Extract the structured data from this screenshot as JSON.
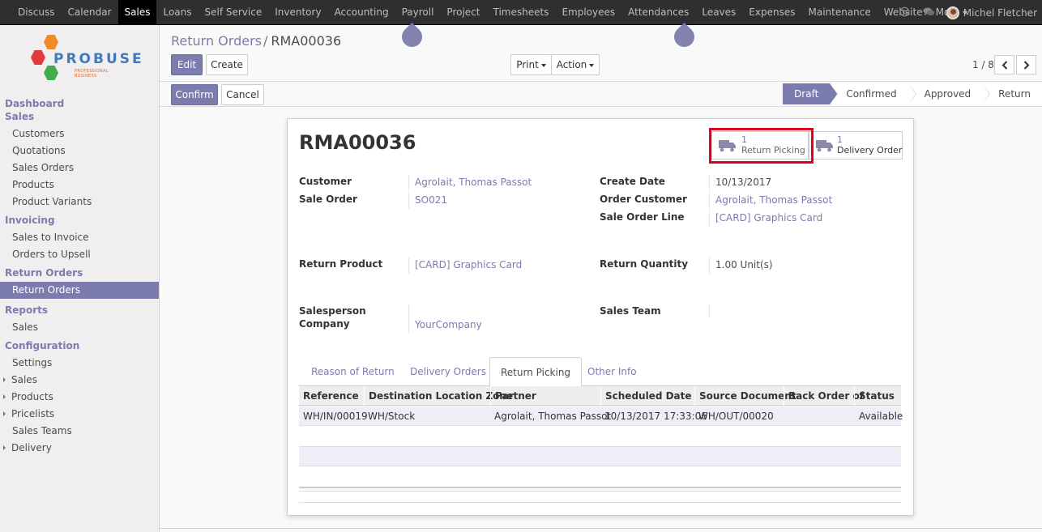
{
  "topbar": {
    "menu": [
      "Discuss",
      "Calendar",
      "Sales",
      "Loans",
      "Self Service",
      "Inventory",
      "Accounting",
      "Payroll",
      "Project",
      "Timesheets",
      "Employees",
      "Attendances",
      "Leaves",
      "Expenses",
      "Maintenance",
      "Website",
      "More"
    ],
    "active": "Sales",
    "user_name": "Michel Fletcher",
    "icons": [
      "at-icon",
      "chat-icon",
      "avatar"
    ]
  },
  "logo": {
    "brand": "PROBUSE",
    "tagline": "PROFESSIONAL BUSINESS"
  },
  "sidebar": {
    "dashboard": "Dashboard",
    "sales_head": "Sales",
    "sales_items": [
      "Customers",
      "Quotations",
      "Sales Orders",
      "Products",
      "Product Variants"
    ],
    "invoicing_head": "Invoicing",
    "invoicing_items": [
      "Sales to Invoice",
      "Orders to Upsell"
    ],
    "return_head": "Return Orders",
    "return_items": [
      "Return Orders"
    ],
    "reports_head": "Reports",
    "reports_items": [
      "Sales"
    ],
    "config_head": "Configuration",
    "config_items": [
      "Settings"
    ],
    "config_sub": [
      "Sales",
      "Products",
      "Pricelists"
    ],
    "config_items2": [
      "Sales Teams"
    ],
    "config_sub2": [
      "Delivery"
    ]
  },
  "breadcrumb": {
    "parent": "Return Orders",
    "separator": "/",
    "current": "RMA00036"
  },
  "buttons": {
    "edit": "Edit",
    "create": "Create",
    "print": "Print",
    "action": "Action",
    "confirm": "Confirm",
    "cancel": "Cancel"
  },
  "pager": {
    "value": "1 / 8"
  },
  "stages": [
    "Draft",
    "Confirmed",
    "Approved",
    "Return"
  ],
  "active_stage": "Draft",
  "record": {
    "name": "RMA00036",
    "smart_buttons": [
      {
        "count": "1",
        "label": "Return Picking"
      },
      {
        "count": "1",
        "label": "Delivery Order"
      }
    ],
    "fields": {
      "customer_label": "Customer",
      "customer": "Agrolait, Thomas Passot",
      "sale_order_label": "Sale Order",
      "sale_order": "SO021",
      "create_date_label": "Create Date",
      "create_date": "10/13/2017",
      "order_customer_label": "Order Customer",
      "order_customer": "Agrolait, Thomas Passot",
      "sale_order_line_label": "Sale Order Line",
      "sale_order_line": "[CARD] Graphics Card",
      "return_product_label": "Return Product",
      "return_product": "[CARD] Graphics Card",
      "return_quantity_label": "Return Quantity",
      "return_quantity": "1.00",
      "return_quantity_unit": "Unit(s)",
      "salesperson_label": "Salesperson",
      "company_label": "Company",
      "company": "YourCompany",
      "sales_team_label": "Sales Team"
    }
  },
  "tabs": [
    "Reason of Return",
    "Delivery Orders",
    "Return Picking",
    "Other Info"
  ],
  "active_tab": "Return Picking",
  "table": {
    "columns": [
      "Reference",
      "Destination Location Zone",
      "Partner",
      "Scheduled Date",
      "Source Document",
      "Back Order of",
      "Status"
    ],
    "rows": [
      [
        "WH/IN/00019",
        "WH/Stock",
        "Agrolait, Thomas Passot",
        "10/13/2017 17:33:06",
        "WH/OUT/00020",
        "",
        "Available"
      ]
    ]
  },
  "colors": {
    "primary": "#7c7bad",
    "topbar": "#2f2f2f",
    "highlight": "#e0001b"
  }
}
